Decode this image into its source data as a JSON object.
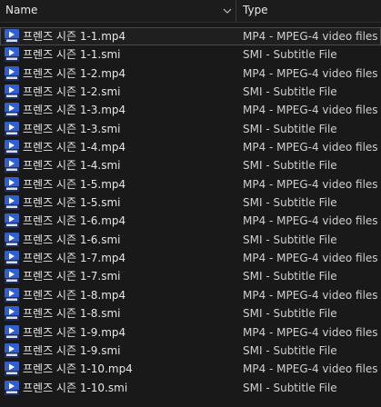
{
  "columns": {
    "name": "Name",
    "type": "Type"
  },
  "files": [
    {
      "name": "프렌즈 시즌 1-1.mp4",
      "type": "MP4 - MPEG-4 video files",
      "icon": "video-file-icon",
      "selected": true
    },
    {
      "name": "프렌즈 시즌 1-1.smi",
      "type": "SMI - Subtitle File",
      "icon": "video-file-icon"
    },
    {
      "name": "프렌즈 시즌 1-2.mp4",
      "type": "MP4 - MPEG-4 video files",
      "icon": "video-file-icon"
    },
    {
      "name": "프렌즈 시즌 1-2.smi",
      "type": "SMI - Subtitle File",
      "icon": "video-file-icon"
    },
    {
      "name": "프렌즈 시즌 1-3.mp4",
      "type": "MP4 - MPEG-4 video files",
      "icon": "video-file-icon"
    },
    {
      "name": "프렌즈 시즌 1-3.smi",
      "type": "SMI - Subtitle File",
      "icon": "video-file-icon"
    },
    {
      "name": "프렌즈 시즌 1-4.mp4",
      "type": "MP4 - MPEG-4 video files",
      "icon": "video-file-icon"
    },
    {
      "name": "프렌즈 시즌 1-4.smi",
      "type": "SMI - Subtitle File",
      "icon": "video-file-icon"
    },
    {
      "name": "프렌즈 시즌 1-5.mp4",
      "type": "MP4 - MPEG-4 video files",
      "icon": "video-file-icon"
    },
    {
      "name": "프렌즈 시즌 1-5.smi",
      "type": "SMI - Subtitle File",
      "icon": "video-file-icon"
    },
    {
      "name": "프렌즈 시즌 1-6.mp4",
      "type": "MP4 - MPEG-4 video files",
      "icon": "video-file-icon"
    },
    {
      "name": "프렌즈 시즌 1-6.smi",
      "type": "SMI - Subtitle File",
      "icon": "video-file-icon"
    },
    {
      "name": "프렌즈 시즌 1-7.mp4",
      "type": "MP4 - MPEG-4 video files",
      "icon": "video-file-icon"
    },
    {
      "name": "프렌즈 시즌 1-7.smi",
      "type": "SMI - Subtitle File",
      "icon": "video-file-icon"
    },
    {
      "name": "프렌즈 시즌 1-8.mp4",
      "type": "MP4 - MPEG-4 video files",
      "icon": "video-file-icon"
    },
    {
      "name": "프렌즈 시즌 1-8.smi",
      "type": "SMI - Subtitle File",
      "icon": "video-file-icon"
    },
    {
      "name": "프렌즈 시즌 1-9.mp4",
      "type": "MP4 - MPEG-4 video files",
      "icon": "video-file-icon"
    },
    {
      "name": "프렌즈 시즌 1-9.smi",
      "type": "SMI - Subtitle File",
      "icon": "video-file-icon"
    },
    {
      "name": "프렌즈 시즌 1-10.mp4",
      "type": "MP4 - MPEG-4 video files",
      "icon": "video-file-icon"
    },
    {
      "name": "프렌즈 시즌 1-10.smi",
      "type": "SMI - Subtitle File",
      "icon": "video-file-icon"
    }
  ],
  "colors": {
    "background": "#191919",
    "icon_blue": "#2f5fd0",
    "icon_dark": "#1b2d63"
  }
}
